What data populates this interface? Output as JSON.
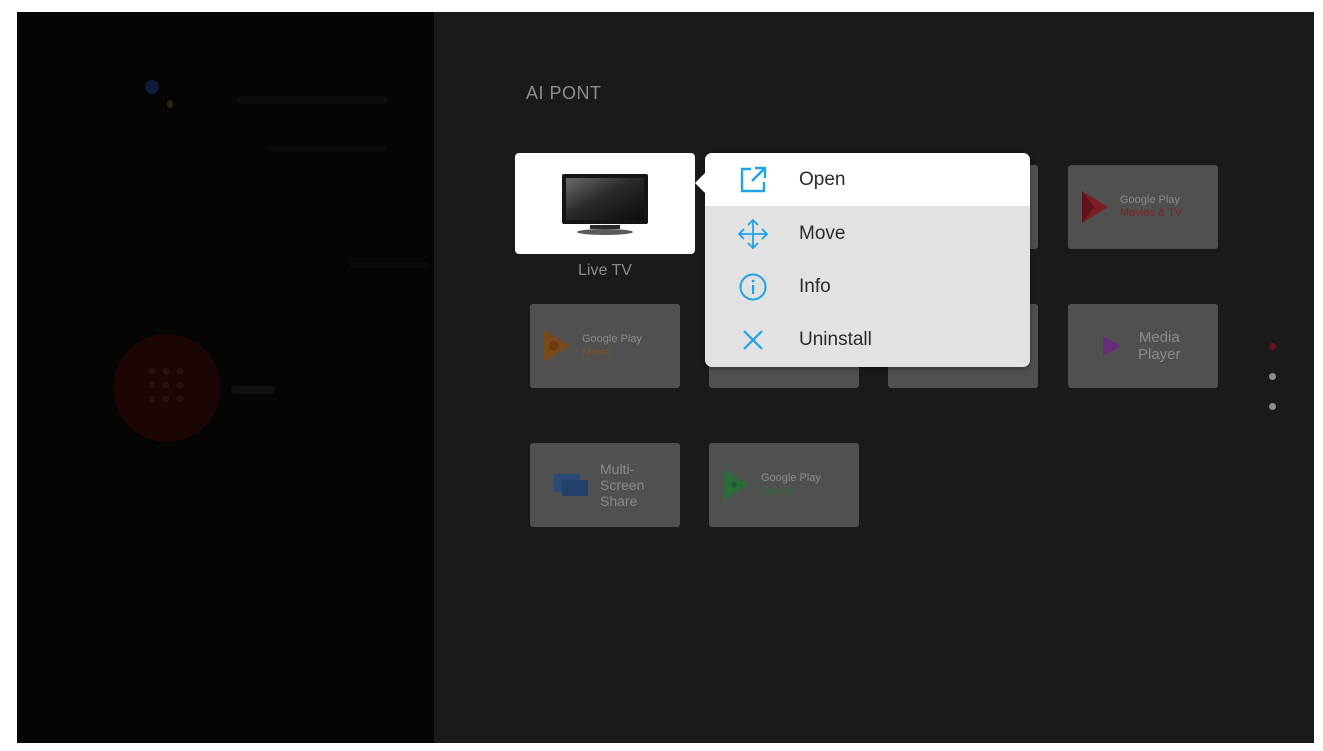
{
  "section": {
    "title": "AI PONT"
  },
  "selected_app": {
    "label": "Live TV"
  },
  "context_menu": {
    "items": [
      {
        "label": "Open",
        "icon": "open-external-icon"
      },
      {
        "label": "Move",
        "icon": "move-arrows-icon"
      },
      {
        "label": "Info",
        "icon": "info-icon"
      },
      {
        "label": "Uninstall",
        "icon": "close-x-icon"
      }
    ]
  },
  "apps": {
    "google_play_movies": {
      "line1": "Google Play",
      "line2": "Movies & TV"
    },
    "google_play_music": {
      "line1": "Google Play",
      "line2": "Music"
    },
    "media_player": {
      "line1": "Media",
      "line2": "Player"
    },
    "multi_screen": {
      "line1": "Multi-",
      "line2": "Screen",
      "line3": "Share"
    },
    "google_play_games": {
      "line1": "Google Play",
      "line2": "Games"
    }
  },
  "page_indicator": {
    "count": 3,
    "active_index": 0
  },
  "colors": {
    "accent_blue": "#1ea3e6",
    "menu_bg": "#e2e2e2",
    "menu_active_bg": "#ffffff"
  }
}
